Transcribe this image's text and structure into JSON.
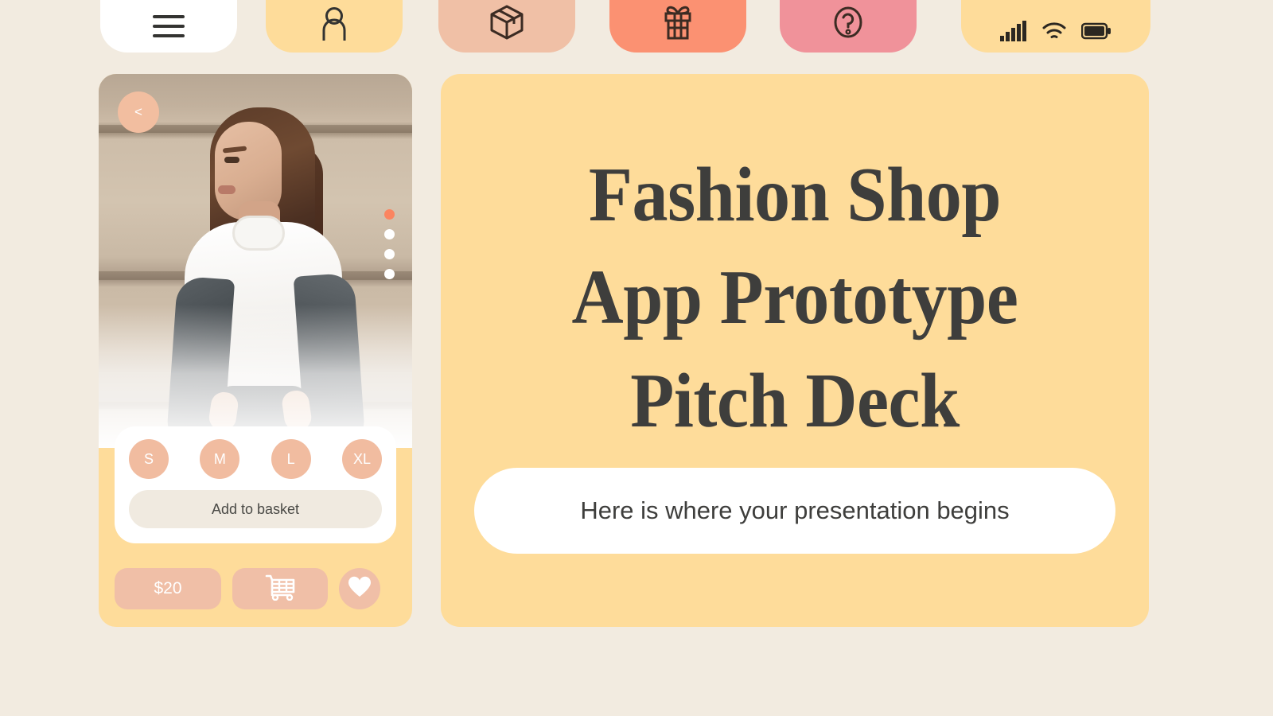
{
  "theme": {
    "page_background": "#F2EBE0",
    "card_yellow": "#FEDC9A",
    "peach": "#F0C0A6",
    "coral": "#FB9172",
    "pink": "#F0929A",
    "white": "#FFFFFF",
    "ink": "#3E3E3C",
    "accent_dot": "#FB8560"
  },
  "tabbar": {
    "tabs": [
      {
        "name": "menu",
        "icon": "hamburger-menu-icon",
        "color": "#FFFFFF"
      },
      {
        "name": "user",
        "icon": "user-profile-icon",
        "color": "#FEDC9A"
      },
      {
        "name": "orders",
        "icon": "package-box-icon",
        "color": "#F0C0A6"
      },
      {
        "name": "gifts",
        "icon": "gift-icon",
        "color": "#FB9172"
      },
      {
        "name": "help",
        "icon": "question-circle-icon",
        "color": "#F0929A"
      }
    ],
    "status": {
      "color": "#FEDC9A",
      "icons": [
        "signal-bars-icon",
        "wifi-icon",
        "battery-icon"
      ]
    }
  },
  "phone": {
    "back_button_label": "<",
    "carousel": {
      "total": 4,
      "active_index": 0
    },
    "photo_alt": "fashion-model-photo",
    "sizes": [
      {
        "label": "S"
      },
      {
        "label": "M"
      },
      {
        "label": "L"
      },
      {
        "label": "XL"
      }
    ],
    "add_to_basket_label": "Add to basket",
    "price": "$20",
    "cart_icon": "shopping-cart-icon",
    "favorite_icon": "heart-icon"
  },
  "content": {
    "title_lines": [
      "Fashion Shop",
      "App Prototype",
      "Pitch Deck"
    ],
    "subtitle": "Here is where your presentation begins"
  }
}
